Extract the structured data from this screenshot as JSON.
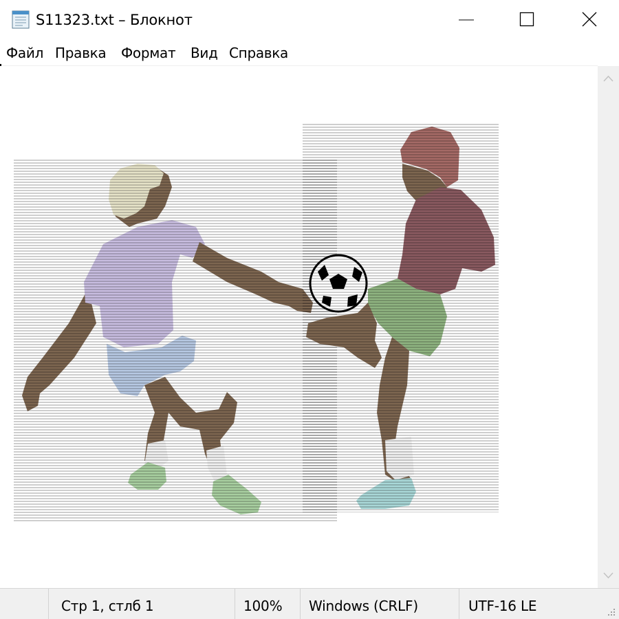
{
  "window": {
    "title": "S11323.txt – Блокнот",
    "icon": "notepad-icon",
    "controls": {
      "minimize_icon": "minimize-icon",
      "maximize_icon": "maximize-icon",
      "close_icon": "close-icon"
    }
  },
  "menu": {
    "file": "Файл",
    "edit": "Правка",
    "format": "Формат",
    "view": "Вид",
    "help": "Справка"
  },
  "editor": {
    "content_description_icon": "ascii-art-image",
    "colors": {
      "hair_left": "#e6e3c8",
      "shirt_left": "#c8bde0",
      "shorts_left": "#b7c9e3",
      "skin": "#7d6650",
      "shoes_left": "#a8cfa0",
      "hair_right": "#a56a66",
      "shirt_right": "#8a5a60",
      "shorts_right": "#8fb481",
      "shoe_right": "#a9d8d8",
      "outline": "#000000"
    }
  },
  "statusbar": {
    "position": "Стр 1, стлб 1",
    "zoom": "100%",
    "line_endings": "Windows (CRLF)",
    "encoding": "UTF-16 LE"
  },
  "scrollbar": {
    "up_icon": "scroll-up-arrow-icon",
    "down_icon": "scroll-down-arrow-icon"
  }
}
